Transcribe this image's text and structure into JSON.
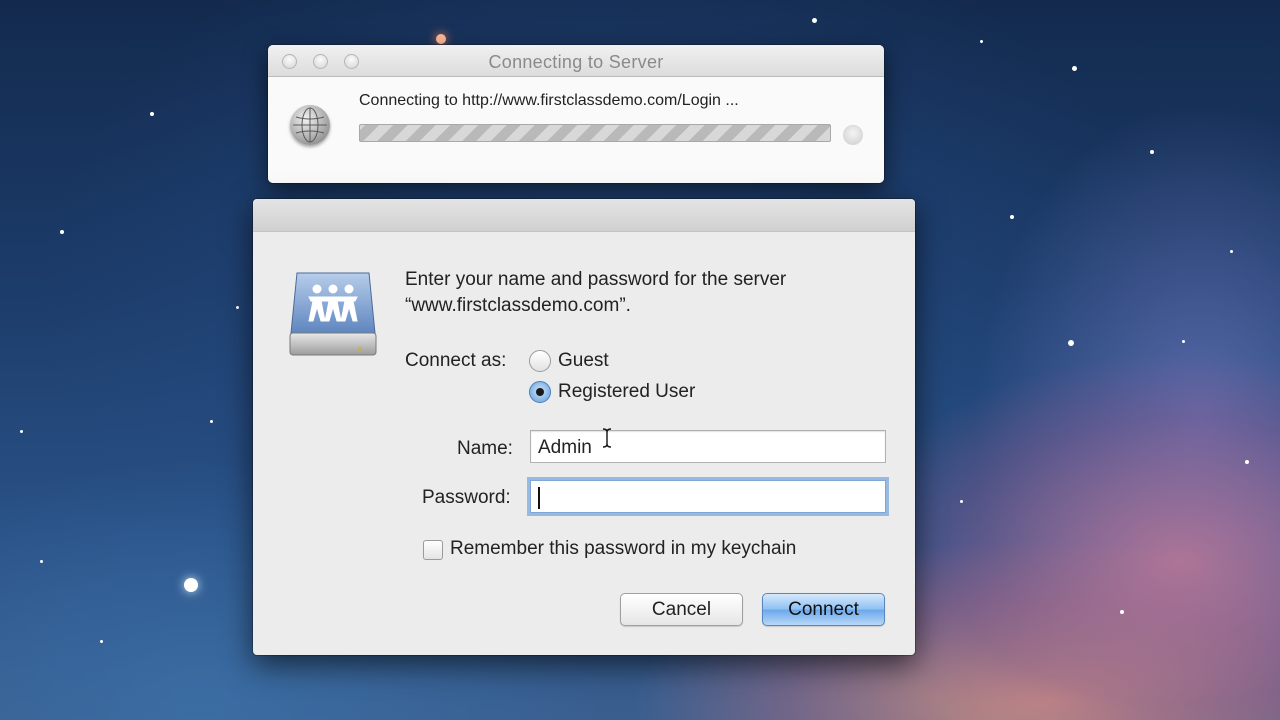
{
  "connecting_window": {
    "title": "Connecting to Server",
    "status": "Connecting to http://www.firstclassdemo.com/Login ...",
    "progress_percent": 100
  },
  "login": {
    "prompt_line1": "Enter your name and password for the server",
    "prompt_line2": "“www.firstclassdemo.com”.",
    "connect_as_label": "Connect as:",
    "option_guest": "Guest",
    "option_registered": "Registered User",
    "selected_option": "Registered User",
    "name_label": "Name:",
    "name_value": "Admin",
    "password_label": "Password:",
    "password_value": "",
    "remember_label": "Remember this password in my keychain",
    "remember_checked": false,
    "cancel_label": "Cancel",
    "connect_label": "Connect"
  },
  "icons": {
    "window_icon": "globe-icon",
    "server_icon": "shared-server-icon"
  },
  "colors": {
    "accent_blue": "#6aa8ea",
    "focus_ring": "#6ca0dc"
  }
}
